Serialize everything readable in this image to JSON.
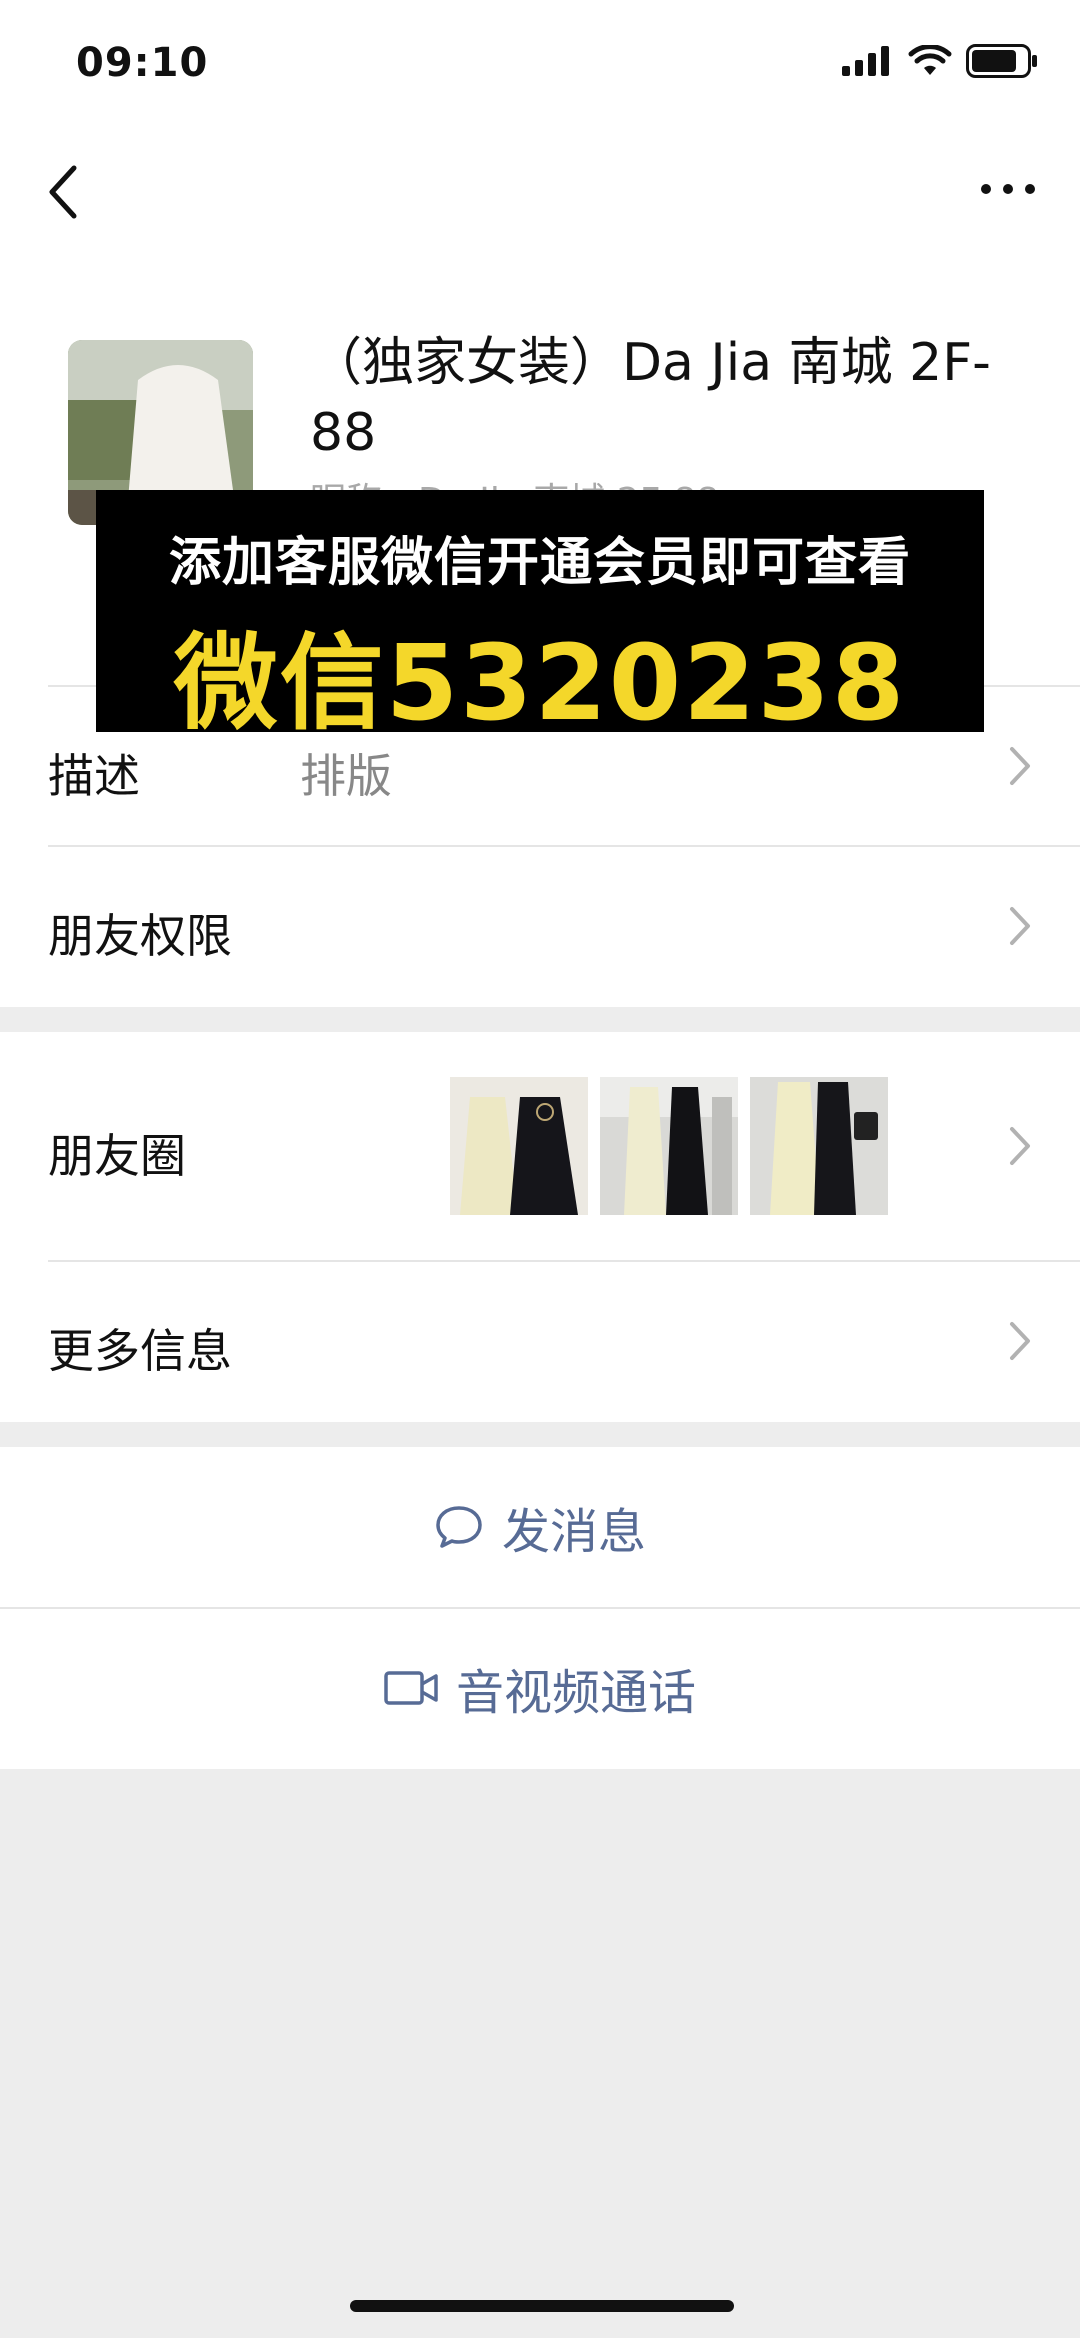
{
  "status": {
    "time": "09:10"
  },
  "profile": {
    "name": "（独家女装）Da Jia 南城 2F-88",
    "nickname_partial": "昵称：Da Jia 南城 2F-88"
  },
  "overlay": {
    "line1": "添加客服微信开通会员即可查看",
    "line2": "微信5320238"
  },
  "rows": {
    "description": {
      "label": "描述",
      "value": "排版"
    },
    "permissions": {
      "label": "朋友权限"
    },
    "moments": {
      "label": "朋友圈"
    },
    "more_info": {
      "label": "更多信息"
    }
  },
  "actions": {
    "message": "发消息",
    "call": "音视频通话"
  },
  "colors": {
    "link": "#576b95",
    "overlay_yellow": "#f4d72a",
    "background": "#ededed"
  }
}
